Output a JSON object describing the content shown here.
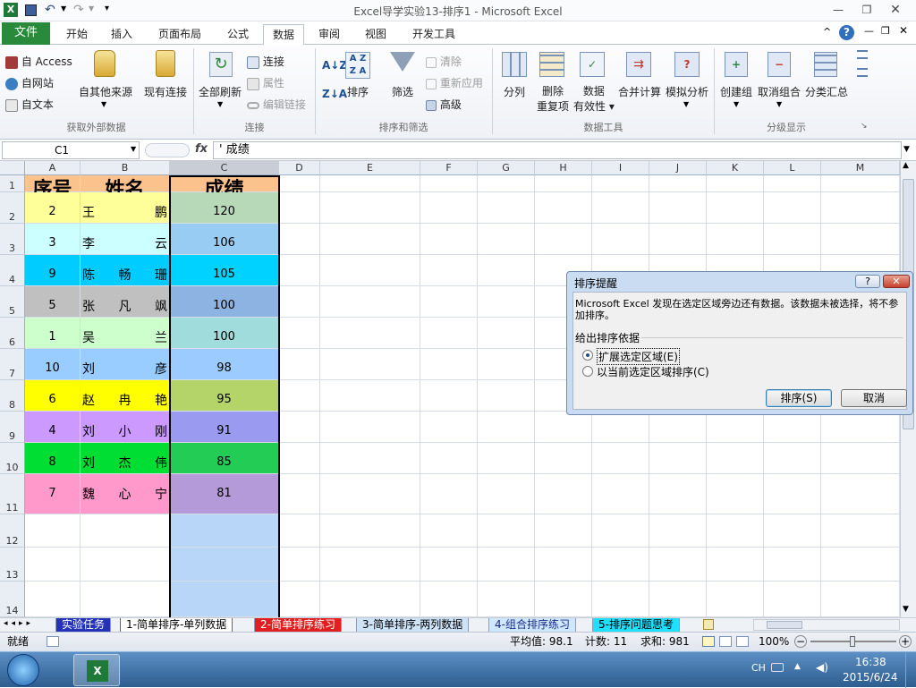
{
  "app_title": "Excel导学实验13-排序1  -  Microsoft Excel",
  "ribbon_tabs": [
    "文件",
    "开始",
    "插入",
    "页面布局",
    "公式",
    "数据",
    "审阅",
    "视图",
    "开发工具"
  ],
  "ribbon": {
    "ext": {
      "access": "自 Access",
      "web": "自网站",
      "text": "自文本",
      "other": "自其他来源",
      "existing": "现有连接",
      "label": "获取外部数据"
    },
    "conn": {
      "refresh": "全部刷新",
      "connections": "连接",
      "properties": "属性",
      "edit_links": "编辑链接",
      "label": "连接"
    },
    "sort": {
      "sort_btn": "排序",
      "filter": "筛选",
      "clear": "清除",
      "reapply": "重新应用",
      "advanced": "高级",
      "label": "排序和筛选"
    },
    "tools": {
      "split": "分列",
      "remove_dup_1": "删除",
      "remove_dup_2": "重复项",
      "valid_1": "数据",
      "valid_2": "有效性",
      "consolidate": "合并计算",
      "whatif": "模拟分析",
      "label": "数据工具"
    },
    "outline": {
      "group": "创建组",
      "ungroup": "取消组合",
      "subtotal": "分类汇总",
      "label": "分级显示"
    }
  },
  "formula_bar": {
    "name_box": "C1",
    "fx": "fx",
    "formula": "' 成绩"
  },
  "columns": [
    "A",
    "B",
    "C",
    "D",
    "E",
    "F",
    "G",
    "H",
    "I",
    "J",
    "K",
    "L",
    "M"
  ],
  "rows": [
    "1",
    "2",
    "3",
    "4",
    "5",
    "6",
    "7",
    "8",
    "9",
    "10",
    "11",
    "12",
    "13",
    "14"
  ],
  "table": {
    "headers": [
      "序号",
      "姓名",
      "成绩"
    ],
    "records": [
      {
        "no": "2",
        "name": [
          "王",
          "鹏"
        ],
        "score": "120",
        "color_ab": "#ffff99",
        "color_c": "#b7d9b8"
      },
      {
        "no": "3",
        "name": [
          "李",
          "云"
        ],
        "score": "106",
        "color_ab": "#ccffff",
        "color_c": "#99ccf3"
      },
      {
        "no": "9",
        "name": [
          "陈",
          "畅",
          "珊"
        ],
        "score": "105",
        "color_ab": "#00ccff",
        "color_c": "#00d2ff"
      },
      {
        "no": "5",
        "name": [
          "张",
          "凡",
          "飒"
        ],
        "score": "100",
        "color_ab": "#c0c0c0",
        "color_c": "#8db3e2"
      },
      {
        "no": "1",
        "name": [
          "吴",
          "兰"
        ],
        "score": "100",
        "color_ab": "#ccffcc",
        "color_c": "#a0dcdc"
      },
      {
        "no": "10",
        "name": [
          "刘",
          "彦"
        ],
        "score": "98",
        "color_ab": "#99ccff",
        "color_c": "#9ccbff"
      },
      {
        "no": "6",
        "name": [
          "赵",
          "冉",
          "艳"
        ],
        "score": "95",
        "color_ab": "#ffff00",
        "color_c": "#b4d46a"
      },
      {
        "no": "4",
        "name": [
          "刘",
          "小",
          "刚"
        ],
        "score": "91",
        "color_ab": "#cc99ff",
        "color_c": "#9a9af0"
      },
      {
        "no": "8",
        "name": [
          "刘",
          "杰",
          "伟"
        ],
        "score": "85",
        "color_ab": "#00dd33",
        "color_c": "#22cc55"
      },
      {
        "no": "7",
        "name": [
          "魏",
          "心",
          "宁"
        ],
        "score": "81",
        "color_ab": "#ff99cc",
        "color_c": "#b49ad8"
      }
    ],
    "header_color": "#fcc28e"
  },
  "sheet_tabs": [
    "实验任务",
    "1-简单排序-单列数据",
    "2-简单排序练习",
    "3-简单排序-两列数据",
    "4-组合排序练习",
    "5-排序问题思考"
  ],
  "status": {
    "ready": "就绪",
    "avg": "平均值: 98.1",
    "count": "计数: 11",
    "sum": "求和: 981",
    "zoom": "100%"
  },
  "dialog": {
    "title": "排序提醒",
    "message": "Microsoft Excel 发现在选定区域旁边还有数据。该数据未被选择，将不参加排序。",
    "group_label": "给出排序依据",
    "opt1": "扩展选定区域(E)",
    "opt2": "以当前选定区域排序(C)",
    "ok": "排序(S)",
    "cancel": "取消"
  },
  "taskbar": {
    "lang": "CH",
    "time": "16:38",
    "date": "2015/6/24"
  }
}
